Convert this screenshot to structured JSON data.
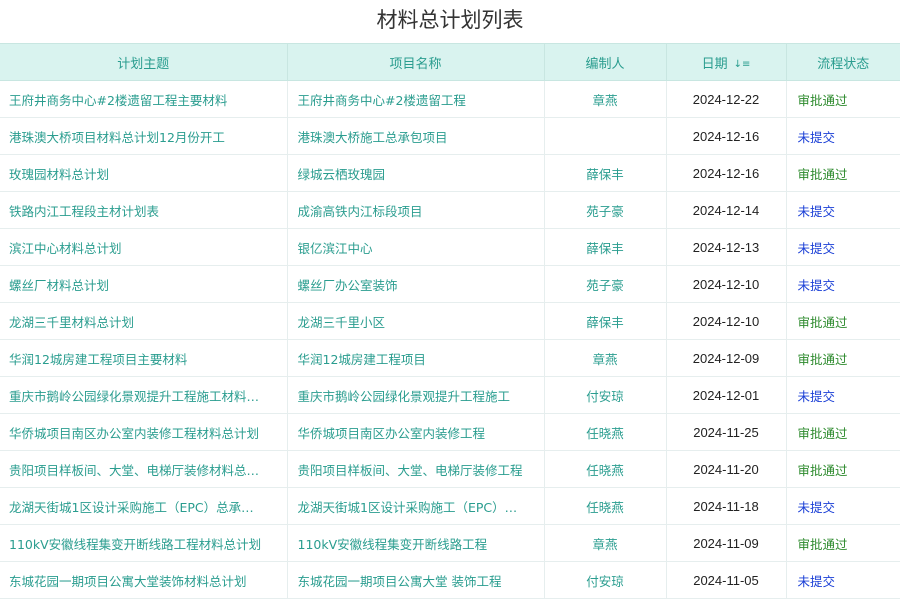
{
  "title": "材料总计划列表",
  "columns": [
    "计划主题",
    "项目名称",
    "编制人",
    "日期",
    "流程状态"
  ],
  "colors": {
    "accent": "#2a9d8f",
    "approved": "#2e8b2e",
    "unsubmitted": "#1a3fd6",
    "header_bg": "#d9f3ef"
  },
  "rows": [
    {
      "topic": "王府井商务中心#2楼遗留工程主要材料",
      "project": "王府井商务中心#2楼遗留工程",
      "editor": "章燕",
      "date": "2024-12-22",
      "status": "审批通过",
      "status_type": "approved"
    },
    {
      "topic": "港珠澳大桥项目材料总计划12月份开工",
      "project": "港珠澳大桥施工总承包项目",
      "editor": "",
      "date": "2024-12-16",
      "status": "未提交",
      "status_type": "unsubmitted"
    },
    {
      "topic": "玫瑰园材料总计划",
      "project": "绿城云栖玫瑰园",
      "editor": "薛保丰",
      "date": "2024-12-16",
      "status": "审批通过",
      "status_type": "approved"
    },
    {
      "topic": "铁路内江工程段主材计划表",
      "project": "成渝高铁内江标段项目",
      "editor": "苑子豪",
      "date": "2024-12-14",
      "status": "未提交",
      "status_type": "unsubmitted"
    },
    {
      "topic": "滨江中心材料总计划",
      "project": "银亿滨江中心",
      "editor": "薛保丰",
      "date": "2024-12-13",
      "status": "未提交",
      "status_type": "unsubmitted"
    },
    {
      "topic": "螺丝厂材料总计划",
      "project": "螺丝厂办公室装饰",
      "editor": "苑子豪",
      "date": "2024-12-10",
      "status": "未提交",
      "status_type": "unsubmitted"
    },
    {
      "topic": "龙湖三千里材料总计划",
      "project": "龙湖三千里小区",
      "editor": "薛保丰",
      "date": "2024-12-10",
      "status": "审批通过",
      "status_type": "approved"
    },
    {
      "topic": "华润12城房建工程项目主要材料",
      "project": "华润12城房建工程项目",
      "editor": "章燕",
      "date": "2024-12-09",
      "status": "审批通过",
      "status_type": "approved"
    },
    {
      "topic": "重庆市鹅岭公园绿化景观提升工程施工材料…",
      "project": "重庆市鹅岭公园绿化景观提升工程施工",
      "editor": "付安琼",
      "date": "2024-12-01",
      "status": "未提交",
      "status_type": "unsubmitted"
    },
    {
      "topic": "华侨城项目南区办公室内装修工程材料总计划",
      "project": "华侨城项目南区办公室内装修工程",
      "editor": "任晓燕",
      "date": "2024-11-25",
      "status": "审批通过",
      "status_type": "approved"
    },
    {
      "topic": "贵阳项目样板间、大堂、电梯厅装修材料总…",
      "project": "贵阳项目样板间、大堂、电梯厅装修工程",
      "editor": "任晓燕",
      "date": "2024-11-20",
      "status": "审批通过",
      "status_type": "approved"
    },
    {
      "topic": "龙湖天街城1区设计采购施工（EPC）总承…",
      "project": "龙湖天街城1区设计采购施工（EPC）…",
      "editor": "任晓燕",
      "date": "2024-11-18",
      "status": "未提交",
      "status_type": "unsubmitted"
    },
    {
      "topic": "110kV安徽线程集变开断线路工程材料总计划",
      "project": "110kV安徽线程集变开断线路工程",
      "editor": "章燕",
      "date": "2024-11-09",
      "status": "审批通过",
      "status_type": "approved"
    },
    {
      "topic": "东城花园一期项目公寓大堂装饰材料总计划",
      "project": "东城花园一期项目公寓大堂 装饰工程",
      "editor": "付安琼",
      "date": "2024-11-05",
      "status": "未提交",
      "status_type": "unsubmitted"
    }
  ]
}
